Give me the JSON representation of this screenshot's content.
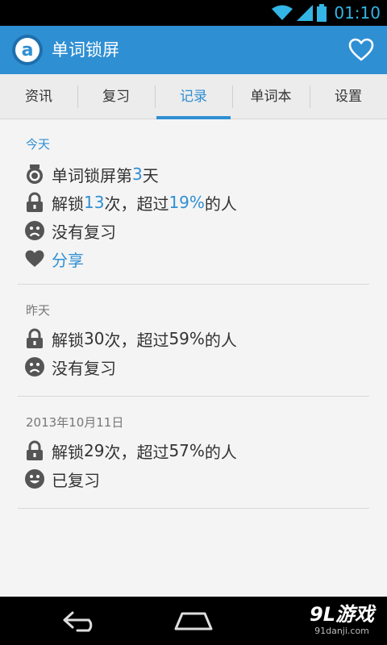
{
  "status_bar": {
    "time": "01:10",
    "wifi_icon": "wifi-icon",
    "signal_icon": "signal-icon",
    "battery_icon": "battery-icon"
  },
  "app": {
    "title": "单词锁屏",
    "logo_letter": "a",
    "favorite_icon": "heart-outline-icon"
  },
  "tabs": [
    {
      "label": "资讯",
      "active": false
    },
    {
      "label": "复习",
      "active": false
    },
    {
      "label": "记录",
      "active": true
    },
    {
      "label": "单词本",
      "active": false
    },
    {
      "label": "设置",
      "active": false
    }
  ],
  "records": [
    {
      "date_label": "今天",
      "date_color": "#2f8fd3",
      "streak": {
        "prefix": "单词锁屏第 ",
        "days": "3",
        "suffix": " 天"
      },
      "unlock": {
        "prefix": "解锁 ",
        "count": "13",
        "mid": " 次，超过 ",
        "percent": "19%",
        "suffix": " 的人"
      },
      "review": {
        "text": "没有复习",
        "icon": "sad-face-icon"
      },
      "share": {
        "text": "分享",
        "icon": "heart-icon"
      }
    },
    {
      "date_label": "昨天",
      "date_color": "#777777",
      "unlock": {
        "prefix": "解锁 ",
        "count": "30",
        "mid": " 次，超过 ",
        "percent": "59%",
        "suffix": " 的人"
      },
      "review": {
        "text": "没有复习",
        "icon": "sad-face-icon"
      }
    },
    {
      "date_label": "2013年10月11日",
      "date_color": "#777777",
      "unlock": {
        "prefix": "解锁 ",
        "count": "29",
        "mid": " 次，超过 ",
        "percent": "57%",
        "suffix": " 的人"
      },
      "review": {
        "text": "已复习",
        "icon": "happy-face-icon"
      }
    }
  ],
  "nav_bar": {
    "back_icon": "back-icon",
    "home_icon": "home-icon"
  },
  "watermark": {
    "main": "9L游戏",
    "sub": "91danji.com"
  },
  "colors": {
    "accent": "#2f8fd3",
    "action_bar": "#2f8fd3",
    "text": "#333333",
    "muted": "#777777"
  }
}
